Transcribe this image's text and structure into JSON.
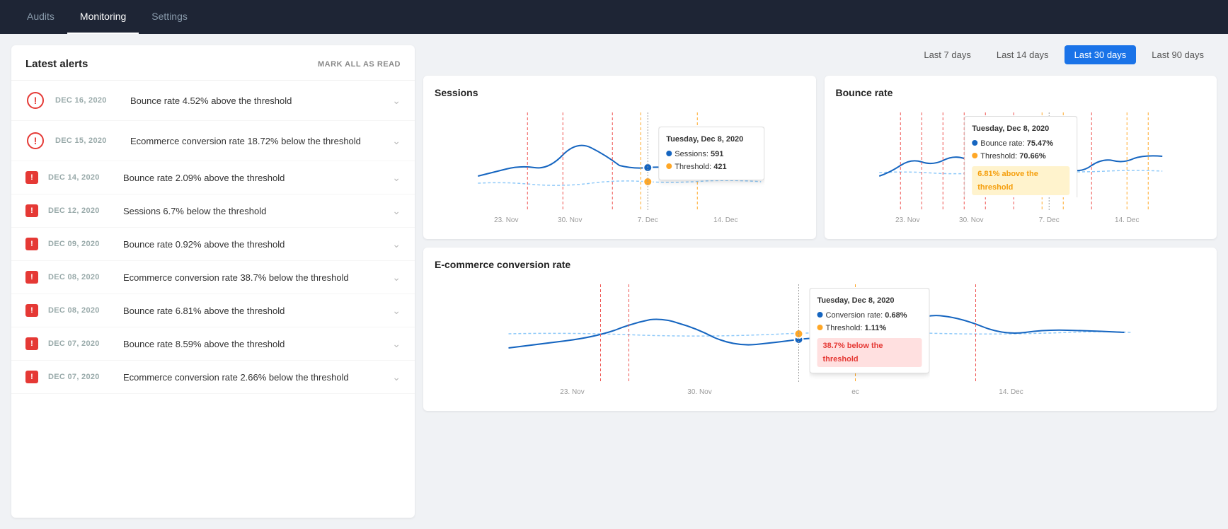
{
  "nav": {
    "tabs": [
      {
        "label": "Audits",
        "active": false
      },
      {
        "label": "Monitoring",
        "active": true
      },
      {
        "label": "Settings",
        "active": false
      }
    ]
  },
  "alerts": {
    "title": "Latest alerts",
    "mark_all_read": "MARK ALL AS READ",
    "items": [
      {
        "date": "DEC 16, 2020",
        "text": "Bounce rate 4.52% above the threshold",
        "level": "critical"
      },
      {
        "date": "DEC 15, 2020",
        "text": "Ecommerce conversion rate 18.72% below the threshold",
        "level": "critical"
      },
      {
        "date": "DEC 14, 2020",
        "text": "Bounce rate 2.09% above the threshold",
        "level": "warning"
      },
      {
        "date": "DEC 12, 2020",
        "text": "Sessions 6.7% below the threshold",
        "level": "warning"
      },
      {
        "date": "DEC 09, 2020",
        "text": "Bounce rate 0.92% above the threshold",
        "level": "warning"
      },
      {
        "date": "DEC 08, 2020",
        "text": "Ecommerce conversion rate 38.7% below the threshold",
        "level": "warning"
      },
      {
        "date": "DEC 08, 2020",
        "text": "Bounce rate 6.81% above the threshold",
        "level": "warning"
      },
      {
        "date": "DEC 07, 2020",
        "text": "Bounce rate 8.59% above the threshold",
        "level": "warning"
      },
      {
        "date": "DEC 07, 2020",
        "text": "Ecommerce conversion rate 2.66% below the threshold",
        "level": "warning"
      }
    ]
  },
  "time_buttons": [
    {
      "label": "Last 7 days",
      "active": false
    },
    {
      "label": "Last 14 days",
      "active": false
    },
    {
      "label": "Last 30 days",
      "active": true
    },
    {
      "label": "Last 90 days",
      "active": false
    }
  ],
  "charts": {
    "sessions": {
      "title": "Sessions",
      "tooltip": {
        "date": "Tuesday, Dec 8, 2020",
        "metric_label": "Sessions",
        "metric_value": "591",
        "threshold_label": "Threshold",
        "threshold_value": "421"
      },
      "x_labels": [
        "23. Nov",
        "30. Nov",
        "7. Dec",
        "14. Dec"
      ]
    },
    "bounce_rate": {
      "title": "Bounce rate",
      "tooltip": {
        "date": "Tuesday, Dec 8, 2020",
        "metric_label": "Bounce rate",
        "metric_value": "75.47%",
        "threshold_label": "Threshold",
        "threshold_value": "70.66%",
        "badge": "6.81% above the threshold"
      },
      "x_labels": [
        "23. Nov",
        "30. Nov",
        "7. Dec",
        "14. Dec"
      ]
    },
    "ecommerce": {
      "title": "E-commerce conversion rate",
      "tooltip": {
        "date": "Tuesday, Dec 8, 2020",
        "metric_label": "Conversion rate",
        "metric_value": "0.68%",
        "threshold_label": "Threshold",
        "threshold_value": "1.11%",
        "badge": "38.7% below the threshold"
      },
      "x_labels": [
        "23. Nov",
        "30. Nov",
        "ec",
        "14. Dec"
      ]
    }
  }
}
